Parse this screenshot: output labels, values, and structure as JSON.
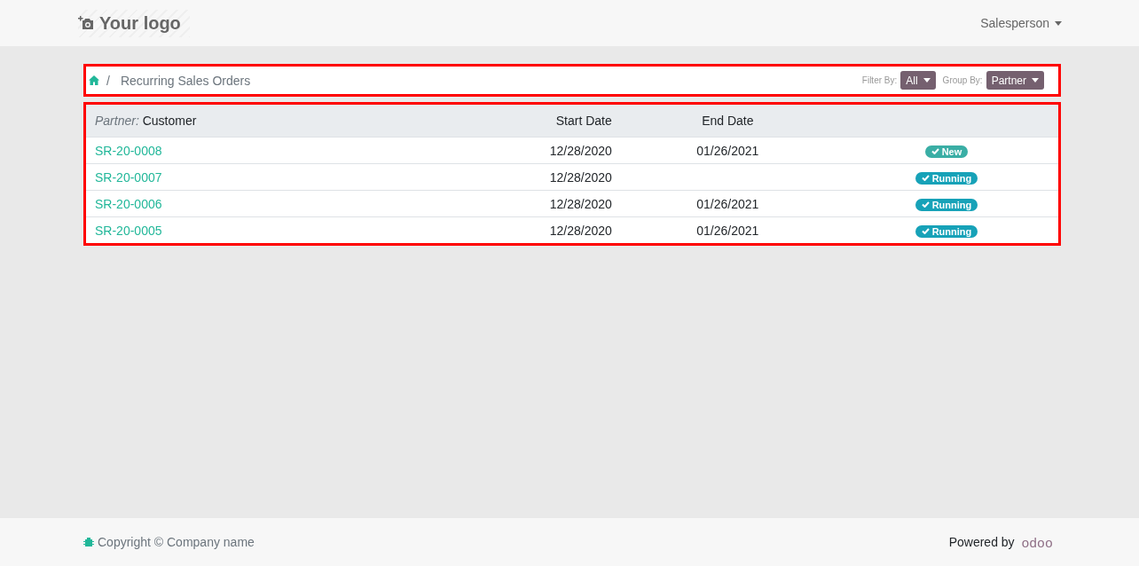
{
  "header": {
    "logo": "Your logo",
    "user_menu": "Salesperson"
  },
  "breadcrumb": {
    "separator": "/",
    "items": [
      "Recurring Sales Orders"
    ]
  },
  "filters": [
    {
      "label": "Filter By:",
      "value": "All"
    },
    {
      "label": "Group By:",
      "value": "Partner"
    }
  ],
  "table": {
    "group_label": "Partner:",
    "columns": [
      "Customer",
      "Start Date",
      "End Date"
    ],
    "rows": [
      {
        "ref": "SR-20-0008",
        "start": "12/28/2020",
        "end": "01/26/2021",
        "status": "New",
        "color": "#3aaea5"
      },
      {
        "ref": "SR-20-0007",
        "start": "12/28/2020",
        "end": "",
        "status": "Running",
        "color": "#17a2b8"
      },
      {
        "ref": "SR-20-0006",
        "start": "12/28/2020",
        "end": "01/26/2021",
        "status": "Running",
        "color": "#17a2b8"
      },
      {
        "ref": "SR-20-0005",
        "start": "12/28/2020",
        "end": "01/26/2021",
        "status": "Running",
        "color": "#17a2b8"
      }
    ]
  },
  "footer": {
    "copyright": "Copyright © Company name",
    "powered_by": "Powered by",
    "brand": "odoo"
  }
}
